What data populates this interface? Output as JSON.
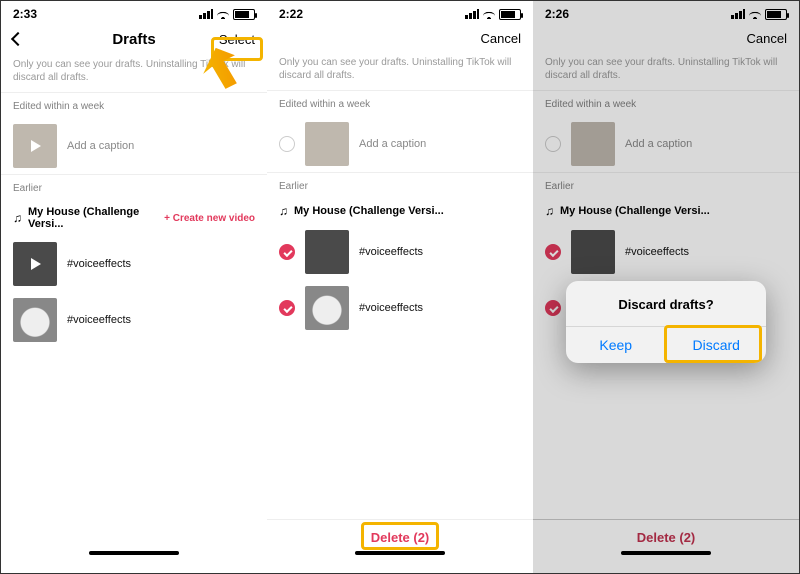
{
  "panels": [
    {
      "time": "2:33",
      "nav": {
        "back": true,
        "title": "Drafts",
        "right": "Select"
      },
      "note": "Only you can see your drafts. Uninstalling TikTok will discard all drafts.",
      "week_label": "Edited within a week",
      "week_item": {
        "caption": "Add a caption"
      },
      "earlier_label": "Earlier",
      "music": "My House (Challenge Versi...",
      "create": "+ Create new video",
      "items": [
        {
          "caption": "#voiceeffects"
        },
        {
          "caption": "#voiceeffects"
        }
      ]
    },
    {
      "time": "2:22",
      "nav": {
        "back": false,
        "title": "",
        "right": "Cancel"
      },
      "note": "Only you can see your drafts. Uninstalling TikTok will discard all drafts.",
      "week_label": "Edited within a week",
      "week_item": {
        "caption": "Add a caption"
      },
      "earlier_label": "Earlier",
      "music": "My House (Challenge Versi...",
      "items": [
        {
          "caption": "#voiceeffects",
          "checked": true
        },
        {
          "caption": "#voiceeffects",
          "checked": true
        }
      ],
      "delete_label": "Delete (2)"
    },
    {
      "time": "2:26",
      "nav": {
        "back": false,
        "title": "",
        "right": "Cancel"
      },
      "note": "Only you can see your drafts. Uninstalling TikTok will discard all drafts.",
      "week_label": "Edited within a week",
      "week_item": {
        "caption": "Add a caption"
      },
      "earlier_label": "Earlier",
      "music": "My House (Challenge Versi...",
      "items": [
        {
          "caption": "#voiceeffects",
          "checked": true
        },
        {
          "caption": "#voiceeffects",
          "checked": true
        }
      ],
      "delete_label": "Delete (2)",
      "dialog": {
        "title": "Discard drafts?",
        "keep": "Keep",
        "discard": "Discard"
      }
    }
  ]
}
